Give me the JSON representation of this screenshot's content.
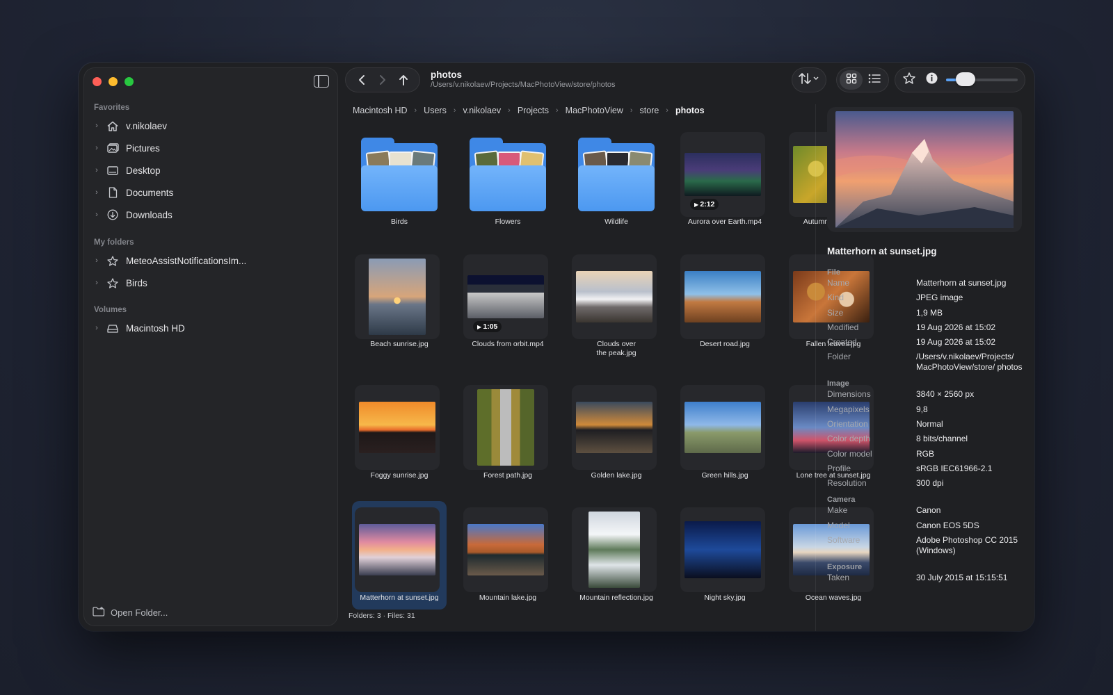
{
  "sidebar": {
    "toggle_icon": "sidebar-toggle-icon",
    "sections": {
      "favorites": "Favorites",
      "my_folders": "My folders",
      "volumes": "Volumes"
    },
    "favorites": [
      {
        "label": "v.nikolaev",
        "icon": "home-icon"
      },
      {
        "label": "Pictures",
        "icon": "pictures-icon"
      },
      {
        "label": "Desktop",
        "icon": "desktop-icon"
      },
      {
        "label": "Documents",
        "icon": "document-icon"
      },
      {
        "label": "Downloads",
        "icon": "download-icon"
      }
    ],
    "my_folders": [
      {
        "label": "MeteoAssistNotificationsIm...",
        "icon": "star-icon"
      },
      {
        "label": "Birds",
        "icon": "star-icon"
      }
    ],
    "volumes": [
      {
        "label": "Macintosh HD",
        "icon": "drive-icon"
      }
    ],
    "open_folder": "Open Folder..."
  },
  "toolbar": {
    "title": "photos",
    "path": "/Users/v.nikolaev/Projects/MacPhotoView/store/photos",
    "zoom_level": 0.18
  },
  "breadcrumb": [
    "Macintosh HD",
    "Users",
    "v.nikolaev",
    "Projects",
    "MacPhotoView",
    "store",
    "photos"
  ],
  "grid": {
    "items": [
      {
        "name": "Birds",
        "kind": "folder"
      },
      {
        "name": "Flowers",
        "kind": "folder"
      },
      {
        "name": "Wildlife",
        "kind": "folder"
      },
      {
        "name": "Aurora over Earth.mp4",
        "kind": "video",
        "duration": "2:12"
      },
      {
        "name": "Autumn leaves.jpg",
        "kind": "image"
      },
      {
        "name": "Beach sunrise.jpg",
        "kind": "image"
      },
      {
        "name": "Clouds from orbit.mp4",
        "kind": "video",
        "duration": "1:05"
      },
      {
        "name": "Clouds over the peak.jpg",
        "kind": "image"
      },
      {
        "name": "Desert road.jpg",
        "kind": "image"
      },
      {
        "name": "Fallen leaves.jpg",
        "kind": "image"
      },
      {
        "name": "Foggy sunrise.jpg",
        "kind": "image"
      },
      {
        "name": "Forest path.jpg",
        "kind": "image"
      },
      {
        "name": "Golden lake.jpg",
        "kind": "image"
      },
      {
        "name": "Green hills.jpg",
        "kind": "image"
      },
      {
        "name": "Lone tree at sunset.jpg",
        "kind": "image"
      },
      {
        "name": "Matterhorn at sunset.jpg",
        "kind": "image",
        "selected": true
      },
      {
        "name": "Mountain lake.jpg",
        "kind": "image"
      },
      {
        "name": "Mountain reflection.jpg",
        "kind": "image"
      },
      {
        "name": "Night sky.jpg",
        "kind": "image"
      },
      {
        "name": "Ocean waves.jpg",
        "kind": "image"
      }
    ]
  },
  "status": "Folders: 3 · Files: 31",
  "inspector": {
    "title": "Matterhorn at sunset.jpg",
    "sections": [
      {
        "heading": "File",
        "rows": [
          {
            "k": "Name",
            "v": "Matterhorn at sunset.jpg"
          },
          {
            "k": "Kind",
            "v": "JPEG image"
          },
          {
            "k": "Size",
            "v": "1,9 MB"
          },
          {
            "k": "Modified",
            "v": "19 Aug 2026 at 15:02"
          },
          {
            "k": "Created",
            "v": "19 Aug 2026 at 15:02"
          },
          {
            "k": "Folder",
            "v": "/Users/v.nikolaev/Projects/ MacPhotoView/store/ photos"
          }
        ]
      },
      {
        "heading": "Image",
        "rows": [
          {
            "k": "Dimensions",
            "v": "3840 × 2560 px"
          },
          {
            "k": "Megapixels",
            "v": "9,8"
          },
          {
            "k": "Orientation",
            "v": "Normal"
          },
          {
            "k": "Color depth",
            "v": "8 bits/channel"
          },
          {
            "k": "Color model",
            "v": "RGB"
          },
          {
            "k": "Profile",
            "v": "sRGB IEC61966-2.1"
          },
          {
            "k": "Resolution",
            "v": "300 dpi"
          }
        ]
      },
      {
        "heading": "Camera",
        "rows": [
          {
            "k": "Make",
            "v": "Canon"
          },
          {
            "k": "Model",
            "v": "Canon EOS 5DS"
          },
          {
            "k": "Software",
            "v": "Adobe Photoshop CC 2015 (Windows)"
          }
        ]
      },
      {
        "heading": "Exposure",
        "rows": [
          {
            "k": "Taken",
            "v": "30 July 2015 at 15:15:51"
          }
        ]
      }
    ]
  },
  "colors": {
    "accent": "#5aa1f5",
    "selection": "#223a5c",
    "folder": "#4c98f0"
  }
}
